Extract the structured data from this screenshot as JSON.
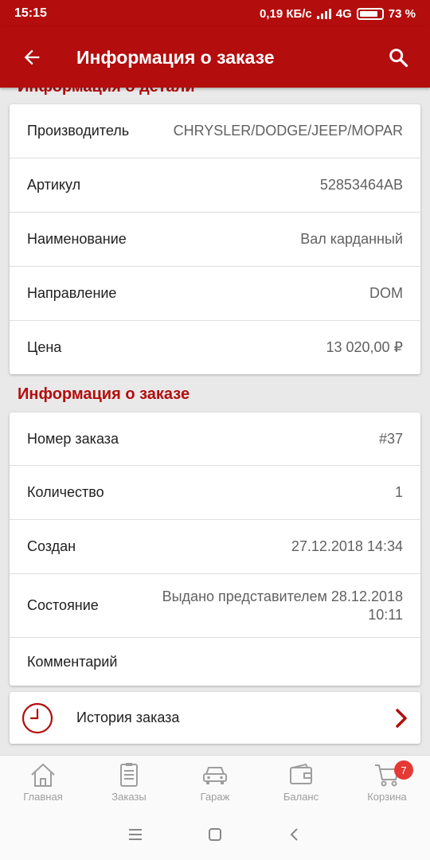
{
  "status_bar": {
    "time": "15:15",
    "speed": "0,19 КБ/с",
    "network": "4G",
    "battery": "73 %"
  },
  "app_bar": {
    "title": "Информация о заказе"
  },
  "part_section": {
    "title": "Информация о детали",
    "rows": [
      {
        "label": "Производитель",
        "value": "CHRYSLER/DODGE/JEEP/MOPAR"
      },
      {
        "label": "Артикул",
        "value": "52853464AB"
      },
      {
        "label": "Наименование",
        "value": "Вал карданный"
      },
      {
        "label": "Направление",
        "value": "DOM"
      },
      {
        "label": "Цена",
        "value": "13 020,00 ₽"
      }
    ]
  },
  "order_section": {
    "title": "Информация о заказе",
    "rows": [
      {
        "label": "Номер заказа",
        "value": "#37"
      },
      {
        "label": "Количество",
        "value": "1"
      },
      {
        "label": "Создан",
        "value": "27.12.2018 14:34"
      },
      {
        "label": "Состояние",
        "value": "Выдано представителем 28.12.2018 10:11"
      },
      {
        "label": "Комментарий",
        "value": ""
      }
    ]
  },
  "history": {
    "label": "История заказа"
  },
  "bottom_nav": {
    "items": [
      {
        "label": "Главная",
        "icon": "home-icon"
      },
      {
        "label": "Заказы",
        "icon": "orders-icon"
      },
      {
        "label": "Гараж",
        "icon": "car-icon"
      },
      {
        "label": "Баланс",
        "icon": "wallet-icon"
      },
      {
        "label": "Корзина",
        "icon": "cart-icon"
      }
    ],
    "cart_badge": "7"
  },
  "colors": {
    "accent": "#b30d0d",
    "badge": "#e53935"
  }
}
